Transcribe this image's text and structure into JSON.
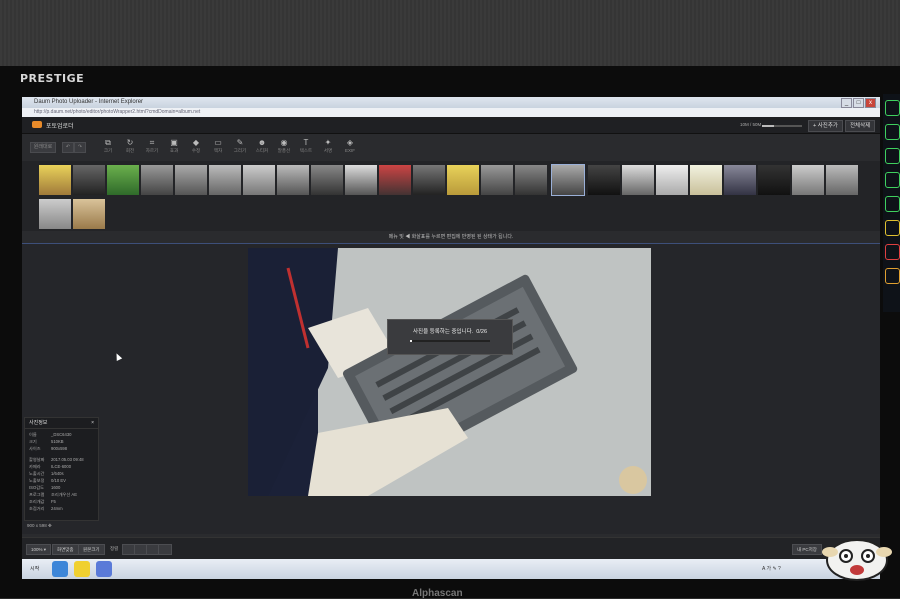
{
  "monitor": {
    "brand": "PRESTIGE",
    "bottom_brand": "Alphascan"
  },
  "window": {
    "title": "Daum Photo Uploader - Internet Explorer",
    "url": "http://p.daum.net/photo/editor/photoWrapper2.html?cmdDomain=album.net",
    "controls": [
      "_",
      "□",
      "x"
    ]
  },
  "app": {
    "title": "포토업로더",
    "zoom_text": "10M / 50M",
    "add_button": "+ 사진추가",
    "delete_all_button": "전체삭제"
  },
  "toolbar": {
    "left_buttons": [
      "원래대로",
      "↶",
      "↷"
    ],
    "tools": [
      {
        "icon": "⧉",
        "label": "크기"
      },
      {
        "icon": "↻",
        "label": "회전"
      },
      {
        "icon": "⌗",
        "label": "자르기"
      },
      {
        "icon": "▣",
        "label": "효과"
      },
      {
        "icon": "◆",
        "label": "수정"
      },
      {
        "icon": "▭",
        "label": "액자"
      },
      {
        "icon": "✎",
        "label": "그리기"
      },
      {
        "icon": "☻",
        "label": "스티커"
      },
      {
        "icon": "◉",
        "label": "말풍선"
      },
      {
        "icon": "T",
        "label": "텍스트"
      },
      {
        "icon": "✦",
        "label": "서명"
      },
      {
        "icon": "◈",
        "label": "EXIF"
      }
    ]
  },
  "notice": "메뉴 및 ◀ 화살표를 누르면 편집에 반영된 된 상태가 됩니다.",
  "upload_modal": {
    "message": "사진을 등록하는 중입니다.",
    "progress": "0/26",
    "progress_fraction": 0.02
  },
  "photo_info": {
    "title": "사진정보",
    "close": "×",
    "rows": [
      {
        "k": "이름",
        "v": "_DSC6430"
      },
      {
        "k": "크기",
        "v": "510KB"
      },
      {
        "k": "사이즈",
        "v": "900x598"
      },
      {
        "k": "촬영날짜",
        "v": "2017.05.03 09:48"
      },
      {
        "k": "카메라",
        "v": "ILCE-6000"
      },
      {
        "k": "노출시간",
        "v": "1/640s"
      },
      {
        "k": "노출보정",
        "v": "0/10 EV"
      },
      {
        "k": "ISO감도",
        "v": "1600"
      },
      {
        "k": "프로그램",
        "v": "조리개우선 AE"
      },
      {
        "k": "조리개값",
        "v": "F5"
      },
      {
        "k": "초점거리",
        "v": "24mm"
      }
    ],
    "dimensions": "900 x 598"
  },
  "bottom": {
    "zoom": "100% ▾",
    "fit": "화면맞춤",
    "original": "원본크기",
    "align_label": "정렬",
    "save_pc": "내 PC저장"
  },
  "taskbar": {
    "start": "시작",
    "tray": "A 가 ✎ ?"
  },
  "colors": {
    "accent": "#3d4f7a",
    "background": "#2a2b2e",
    "logo": "#e98b2a"
  }
}
